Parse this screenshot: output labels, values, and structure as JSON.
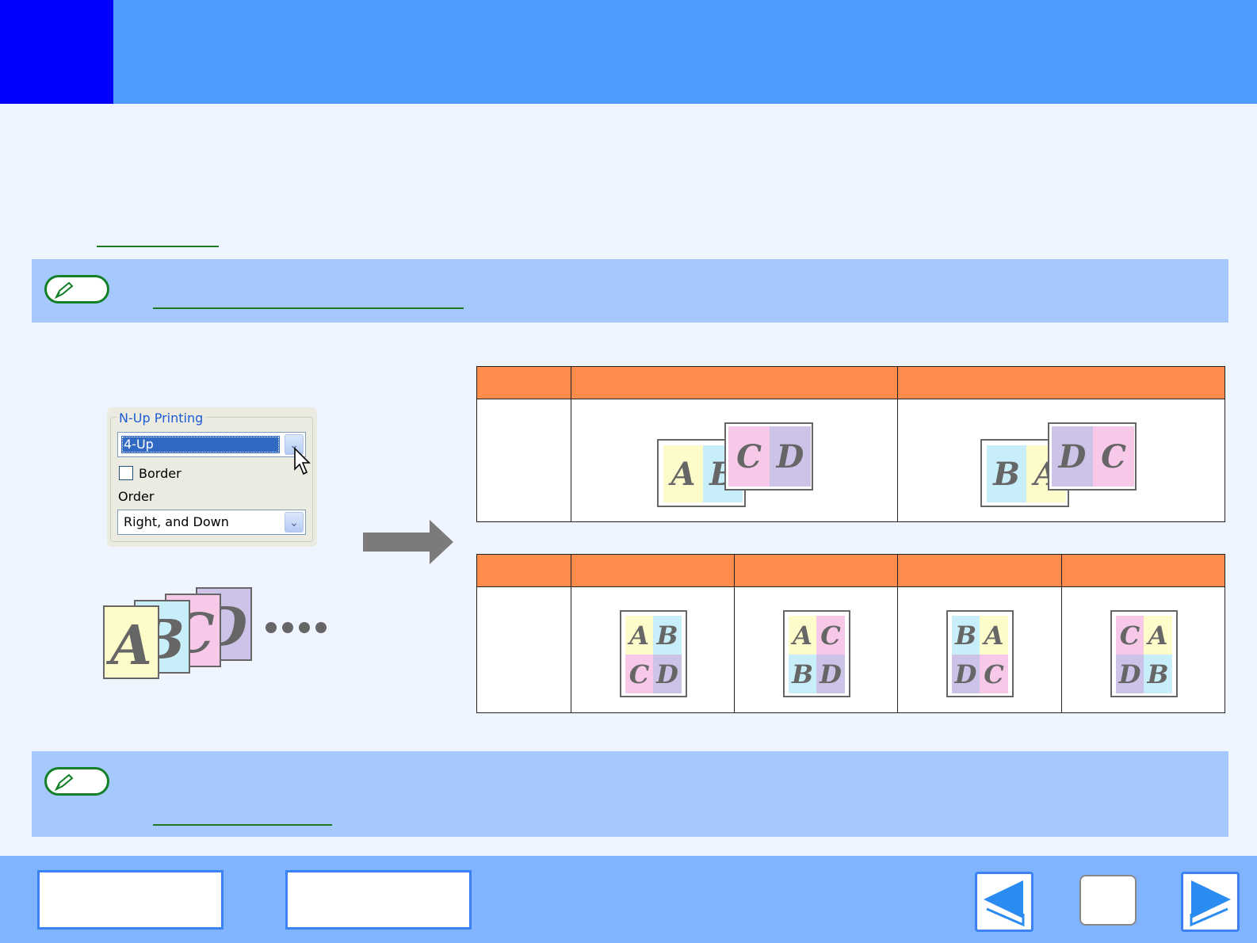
{
  "dialog": {
    "group_label": "N-Up Printing",
    "nup_value": "4-Up",
    "border_label": "Border",
    "order_label": "Order",
    "order_value": "Right, and Down",
    "border_checked": false
  },
  "stack_letters": [
    "A",
    "B",
    "C",
    "D"
  ],
  "two_up_examples": [
    [
      "A",
      "B",
      "C",
      "D"
    ],
    [
      "B",
      "A",
      "D",
      "C"
    ]
  ],
  "four_up_examples": [
    [
      "A",
      "B",
      "C",
      "D"
    ],
    [
      "A",
      "C",
      "B",
      "D"
    ],
    [
      "B",
      "A",
      "D",
      "C"
    ],
    [
      "C",
      "A",
      "D",
      "B"
    ]
  ],
  "colors": {
    "header": "#509cfe",
    "header_block": "#0000fe",
    "table_header": "#ff8c4a",
    "note_band": "#a5c8fd",
    "footer": "#80b4fe",
    "yellow": "#fefbcb",
    "cyan": "#c8eefa",
    "pink": "#f8c8e8",
    "purple": "#cdc3e9"
  },
  "icons": {
    "note": "pencil-note-icon",
    "arrow": "right-arrow-icon",
    "prev": "previous-page-icon",
    "next": "next-page-icon"
  }
}
